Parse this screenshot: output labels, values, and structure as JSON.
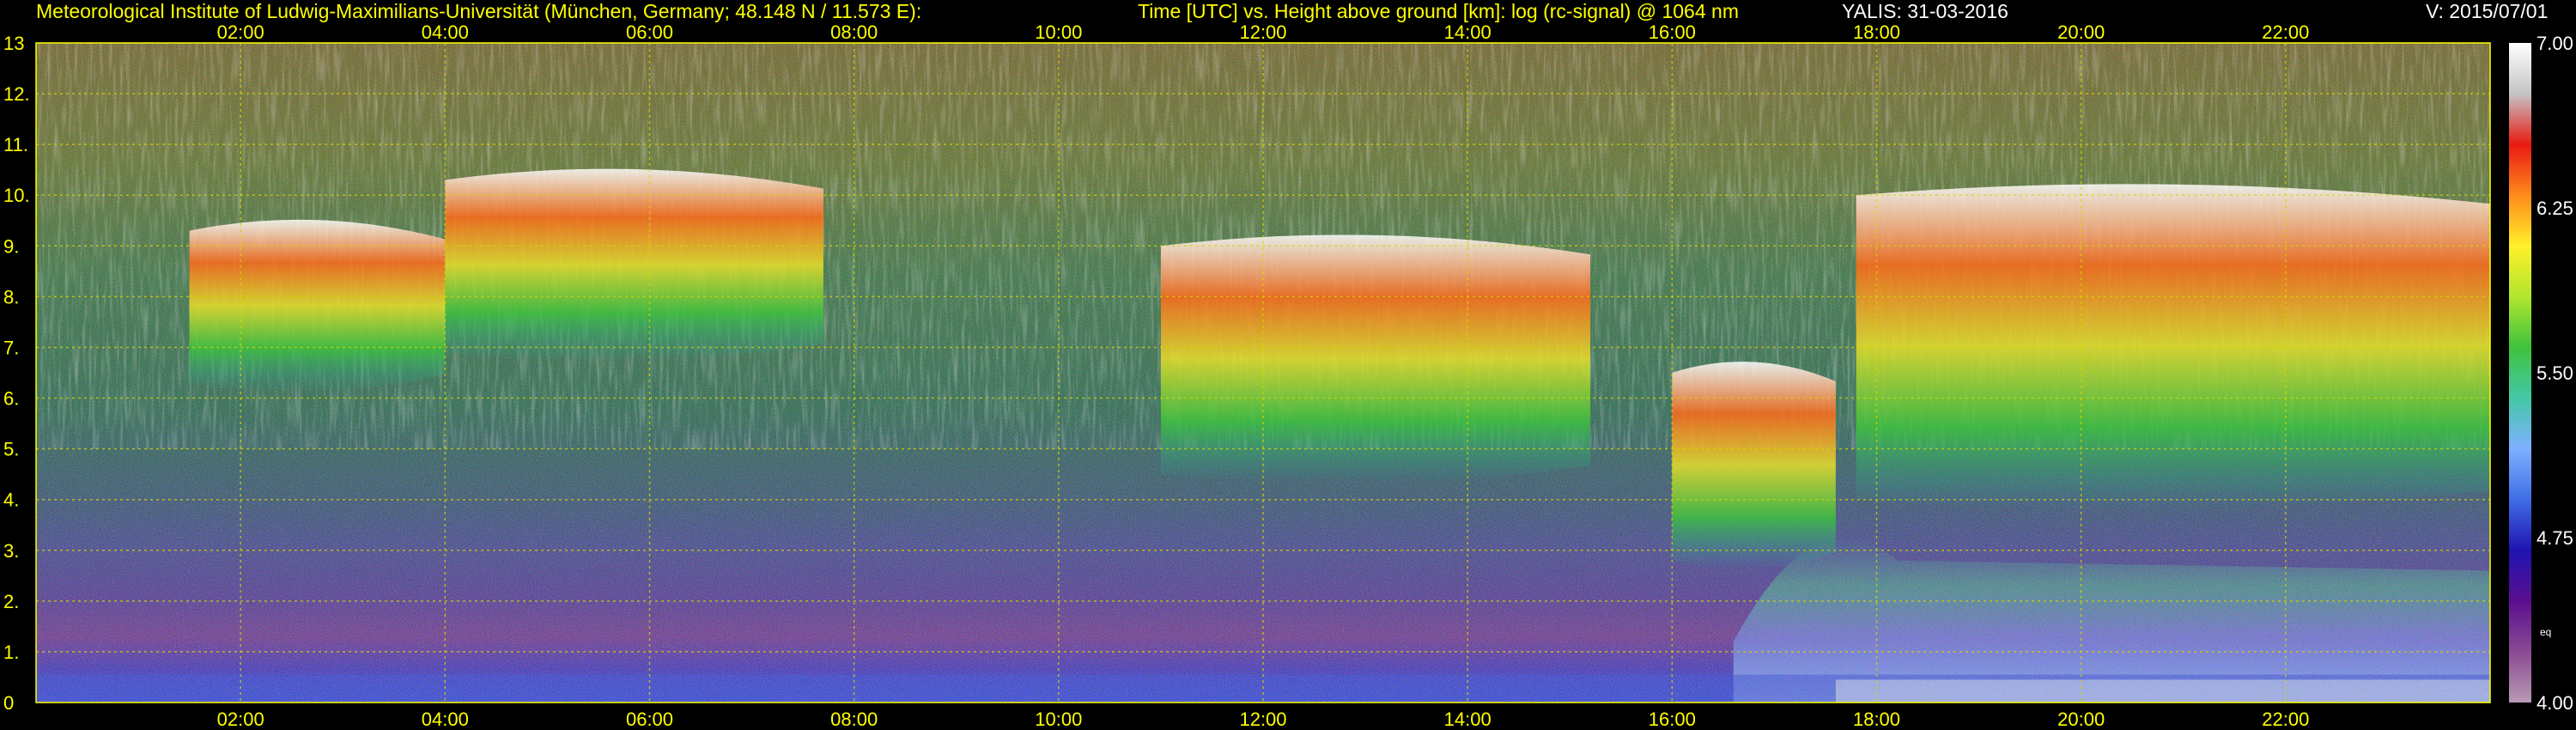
{
  "header": {
    "institute": "Meteorological Institute of Ludwig-Maximilians-Universität (München, Germany; 48.148 N / 11.573 E):",
    "description": "Time [UTC] vs. Height above ground [km]: log (rc-signal) @ 1064 nm",
    "instrument_date": "YALIS: 31-03-2016",
    "version": "V: 2015/07/01"
  },
  "chart_data": {
    "type": "heatmap",
    "title": "Time [UTC] vs. Height above ground [km]: log (rc-signal) @ 1064 nm",
    "xlabel": "",
    "ylabel": "",
    "x_range_hours": [
      0,
      24
    ],
    "x_ticks": [
      "02:00",
      "04:00",
      "06:00",
      "08:00",
      "10:00",
      "12:00",
      "14:00",
      "16:00",
      "18:00",
      "20:00",
      "22:00"
    ],
    "ylim": [
      0,
      13
    ],
    "y_ticks": [
      "0",
      "1.",
      "2.",
      "3.",
      "4.",
      "5.",
      "6.",
      "7.",
      "8.",
      "9.",
      "10.",
      "11.",
      "12.",
      "13"
    ],
    "grid": true,
    "colorbar": {
      "range": [
        4.0,
        7.0
      ],
      "tick_labels": [
        "4.00",
        "4.75",
        "5.50",
        "6.25",
        "7.00"
      ],
      "extra_label": "eq"
    },
    "cloud_layers_km": [
      {
        "start_h": 1.5,
        "end_h": 4.0,
        "base_km": 6.3,
        "top_km": 9.3
      },
      {
        "start_h": 4.0,
        "end_h": 7.7,
        "base_km": 6.9,
        "top_km": 10.3
      },
      {
        "start_h": 11.0,
        "end_h": 15.2,
        "base_km": 4.5,
        "top_km": 9.0
      },
      {
        "start_h": 16.0,
        "end_h": 17.6,
        "base_km": 2.8,
        "top_km": 6.5
      },
      {
        "start_h": 17.8,
        "end_h": 24.0,
        "base_km": 4.0,
        "top_km": 10.0
      }
    ]
  },
  "colors": {
    "background": "#000000",
    "axis_text": "#ffff00",
    "grid": "#d6d600",
    "colorbar_scale": [
      "#b89ab4",
      "#8a4a92",
      "#5a0f8e",
      "#1f14b0",
      "#3f6ee6",
      "#7eb0ff",
      "#44c8a6",
      "#3ec23e",
      "#b0e62e",
      "#fff02a",
      "#ff8a1c",
      "#e81a12",
      "#c4c4c4",
      "#ffffff"
    ]
  }
}
